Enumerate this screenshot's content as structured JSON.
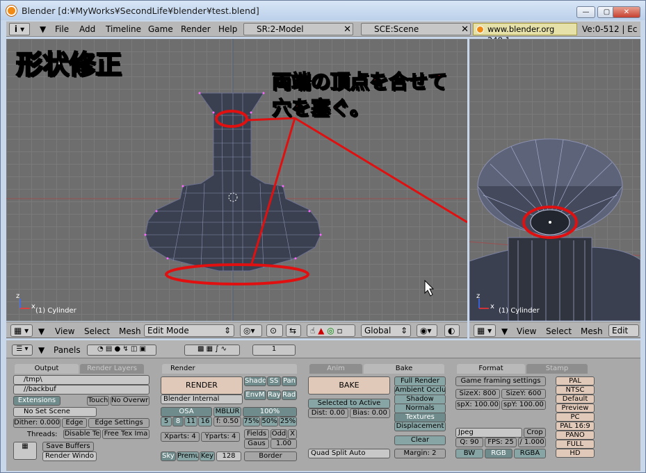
{
  "window": {
    "title": "Blender [d:¥MyWorks¥SecondLife¥blender¥test.blend]",
    "min": "—",
    "max": "▢",
    "close": "✕"
  },
  "menubar": {
    "items": [
      "File",
      "Add",
      "Timeline",
      "Game",
      "Render",
      "Help"
    ],
    "screen": "SR:2-Model",
    "scene": "SCE:Scene",
    "site": "www.blender.org 248.1",
    "stats": "Ve:0-512 | Ec"
  },
  "viewport_main": {
    "object_label": "(1) Cylinder",
    "axis_z": "z",
    "axis_x": "x"
  },
  "viewport_side": {
    "object_label": "(1) Cylinder",
    "axis_z": "z",
    "axis_x": "x"
  },
  "annotations": {
    "title": "形状修正",
    "note_line1": "両端の頂点を合せて",
    "note_line2": "穴を塞ぐ。"
  },
  "header_3d": {
    "view": "View",
    "select": "Select",
    "mesh": "Mesh",
    "mode": "Edit Mode",
    "orientation": "Global"
  },
  "header_3d_side": {
    "view": "View",
    "select": "Select",
    "mesh": "Mesh",
    "mode": "Edit"
  },
  "buttons_header": {
    "panels": "Panels",
    "frame": "1"
  },
  "output_panel": {
    "tab_active": "Output",
    "tab_inactive": "Render Layers",
    "path1": "/tmp\\",
    "path2": "//backbuf",
    "extensions": "Extensions",
    "touch": "Touch",
    "no_overwrite": "No Overwri",
    "set_scene": "No Set Scene",
    "dither": "Dither: 0.000",
    "edge": "Edge",
    "edge_settings": "Edge Settings",
    "threads": "Threads:",
    "disable_tex": "Disable Te",
    "free_tex": "Free Tex Ima",
    "save_buffers": "Save Buffers",
    "render_window": "Render Windo"
  },
  "render_panel": {
    "tab": "Render",
    "render": "RENDER",
    "engine": "Blender Internal",
    "shado": "Shado",
    "ss": "SS",
    "pan": "Pan",
    "envm": "EnvM",
    "ray": "Ray",
    "radi": "Radi",
    "osa": "OSA",
    "osa_values": [
      "5",
      "8",
      "11",
      "16"
    ],
    "mblur": "MBLUR",
    "mblur_f": "f: 0.50",
    "pct": "100%",
    "pcts": [
      "75%",
      "50%",
      "25%"
    ],
    "xparts": "Xparts: 4",
    "yparts": "Yparts: 4",
    "fields": "Fields",
    "odd": "Odd",
    "x": "X",
    "gaus": "Gaus",
    "gaus_val": "1.00",
    "sky": "Sky",
    "premul": "Premu",
    "key": "Key",
    "bits": "128",
    "border": "Border"
  },
  "bake_panel": {
    "tab_inactive": "Anim",
    "tab_active": "Bake",
    "bake": "BAKE",
    "modes": [
      "Full Render",
      "Ambient Occlus",
      "Shadow",
      "Normals",
      "Textures",
      "Displacement"
    ],
    "selected_to_active": "Selected to Active",
    "dist": "Dist: 0.00",
    "bias": "Bias: 0.00",
    "clear": "Clear",
    "quad_split": "Quad Split Auto",
    "margin": "Margin: 2"
  },
  "format_panel": {
    "tab_active": "Format",
    "tab_inactive": "Stamp",
    "framing": "Game framing settings",
    "sizex": "SizeX: 800",
    "sizey": "SizeY: 600",
    "aspx": "spX: 100.00",
    "aspy": "spY: 100.00",
    "format": "Jpeg",
    "crop": "Crop",
    "quality": "Q: 90",
    "fps": "FPS: 25",
    "fps_base": "/ 1.000",
    "bw": "BW",
    "rgb": "RGB",
    "rgba": "RGBA",
    "presets": [
      "PAL",
      "NTSC",
      "Default",
      "Preview",
      "PC",
      "PAL 16:9",
      "PANO",
      "FULL",
      "HD"
    ]
  }
}
